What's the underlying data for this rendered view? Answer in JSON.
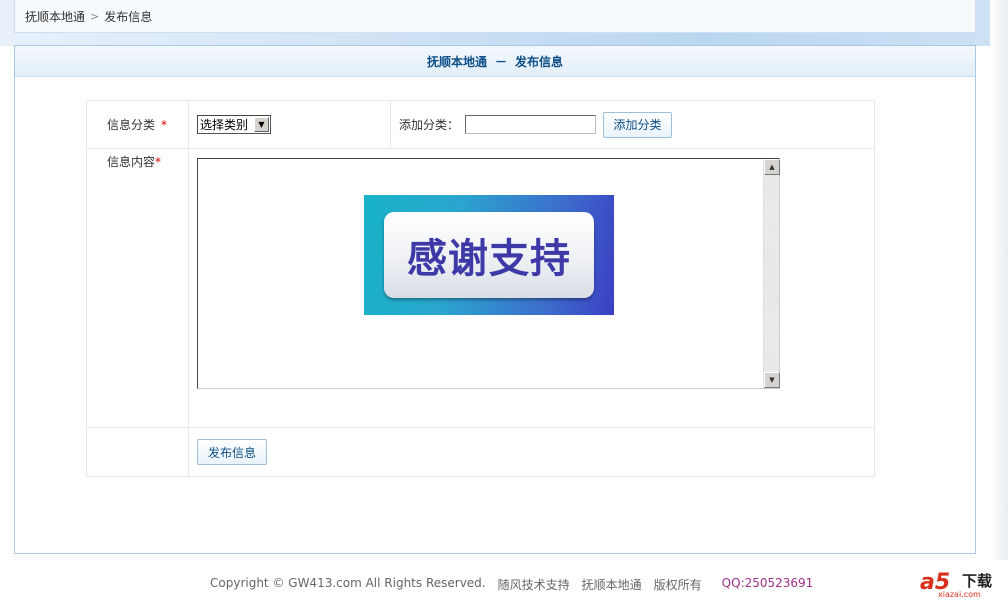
{
  "breadcrumb": {
    "home": "抚顺本地通",
    "separator": ">",
    "current": "发布信息"
  },
  "panel": {
    "title_site": "抚顺本地通",
    "title_dash": "－",
    "title_page": "发布信息"
  },
  "form": {
    "category_label": "信息分类",
    "category_required": "*",
    "category_select_value": "选择类别",
    "add_category_label": "添加分类：",
    "add_category_input_value": "",
    "add_category_button": "添加分类",
    "content_label": "信息内容",
    "content_required": "*",
    "content_image_text": "感谢支持",
    "submit_button": "发布信息"
  },
  "footer": {
    "copyright": "Copyright © GW413.com All Rights Reserved.",
    "support": "随风技术支持",
    "site": "抚顺本地通",
    "rights": "版权所有",
    "qq": "QQ:250523691"
  },
  "logo": {
    "mark": "a5",
    "text": "下载",
    "url": "xiazai.com"
  },
  "icons": {
    "select_arrow": "chevron-down-icon",
    "scroll_up": "scroll-up-icon",
    "scroll_down": "scroll-down-icon"
  },
  "colors": {
    "title_blue": "#0d4f86",
    "required_red": "#dd0000",
    "qq_purple": "#a0308a"
  }
}
